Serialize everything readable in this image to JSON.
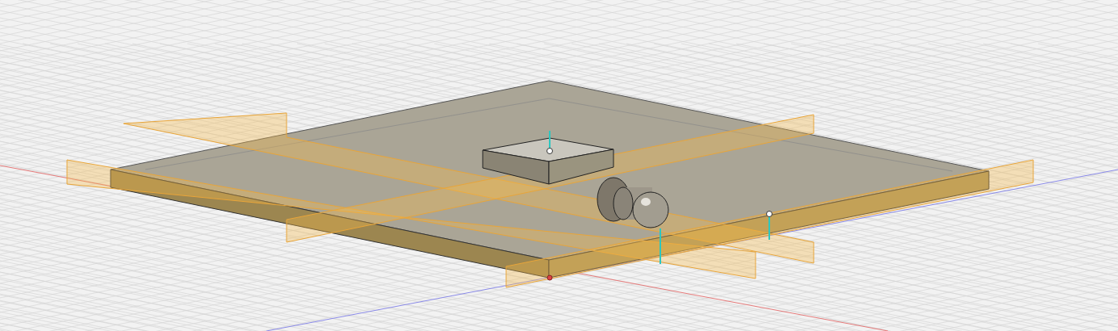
{
  "viewport": {
    "kind": "canvas"
  }
}
